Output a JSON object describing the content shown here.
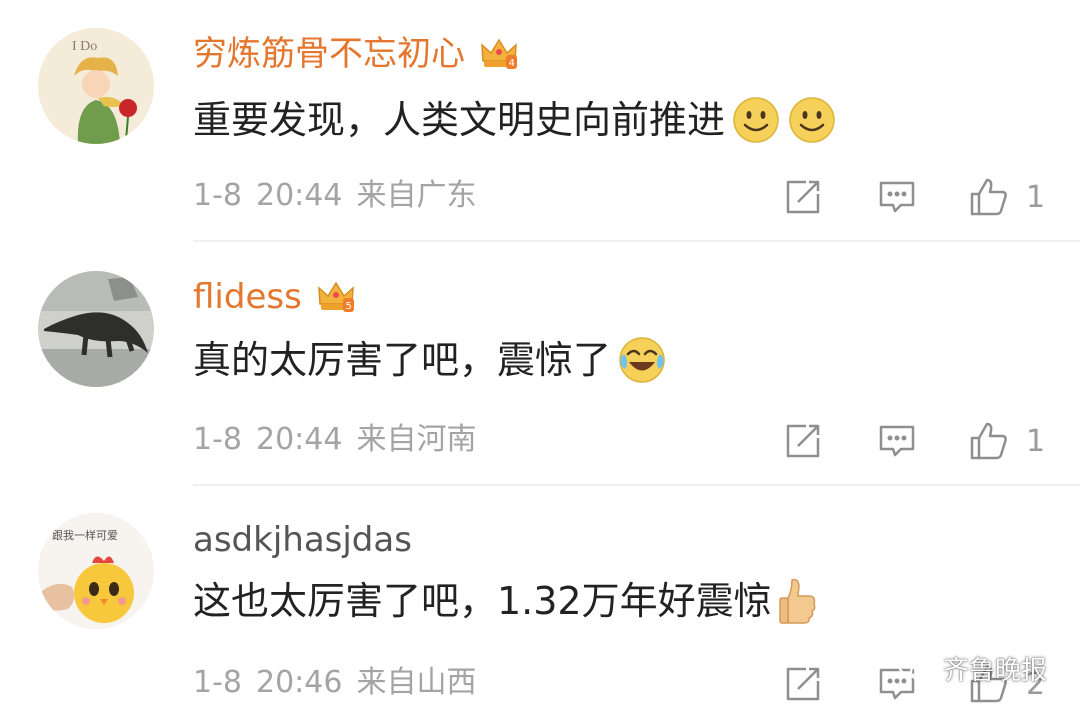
{
  "comments": [
    {
      "username": "穷炼筋骨不忘初心",
      "vip_level": "4",
      "avatar_text": "I Do",
      "content": "重要发现，人类文明史向前推进",
      "date": "1-8",
      "time": "20:44",
      "location": "来自广东",
      "likes": "1"
    },
    {
      "username": "flidess",
      "vip_level": "5",
      "content": "真的太厉害了吧，震惊了",
      "date": "1-8",
      "time": "20:44",
      "location": "来自河南",
      "likes": "1"
    },
    {
      "username": "asdkjhasjdas",
      "avatar_text": "跟我一样可爱",
      "content": "这也太厉害了吧，1.32万年好震惊",
      "date": "1-8",
      "time": "20:46",
      "location": "来自山西",
      "likes": "2"
    }
  ],
  "watermark": "齐鲁晚报",
  "colors": {
    "vip_username": "#e4762d",
    "username": "#555555",
    "meta": "#a4a4a4",
    "divider": "#efefef"
  }
}
